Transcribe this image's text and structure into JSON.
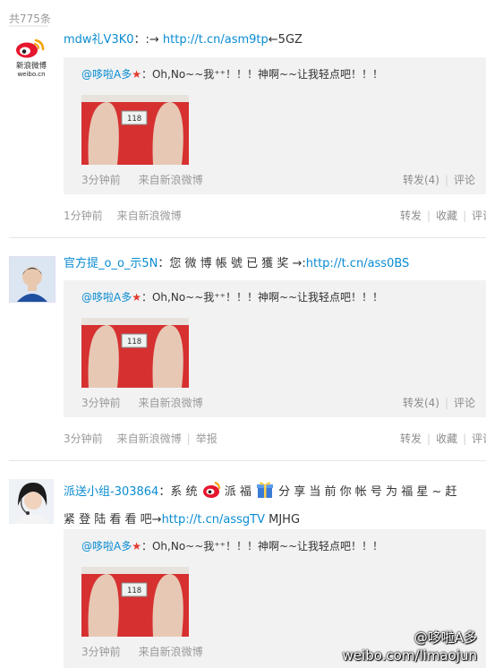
{
  "header": {
    "count_text": "共775条"
  },
  "posts": [
    {
      "author": "mdw礼V3K0",
      "content_prefix": "：:→ ",
      "link": "http://t.cn/asm9tp",
      "content_suffix": "←5GZ",
      "avatar_icon": "sina-weibo-logo-icon",
      "logo_caption_cn": "新浪微博",
      "logo_caption_en": "weibo.cn",
      "repost": {
        "author": "@哆啦A多",
        "text": "：Oh,No~~我⁺⁺！！！神啊~~让我轻点吧！！！",
        "time": "3分钟前",
        "source": "来自新浪微博",
        "forward": "转发(4)",
        "comment": "评论"
      },
      "time": "1分钟前",
      "source": "来自新浪微博",
      "actions": [
        "转发",
        "收藏",
        "评论"
      ]
    },
    {
      "author": "官方提_o_o_示5N",
      "content_prefix": "：您 微 博 帳 號 已 獲 奖 →:",
      "link": "http://t.cn/ass0BS",
      "content_suffix": "",
      "avatar_icon": "user-avatar-icon",
      "repost": {
        "author": "@哆啦A多",
        "text": "：Oh,No~~我⁺⁺！！！神啊~~让我轻点吧！！！",
        "time": "3分钟前",
        "source": "来自新浪微博",
        "forward": "转发(4)",
        "comment": "评论"
      },
      "time": "3分钟前",
      "source": "来自新浪微博",
      "report": "举报",
      "actions": [
        "转发",
        "收藏",
        "评论"
      ]
    },
    {
      "author": "派送小组-303864",
      "content_line1_a": "：系 统 ",
      "content_line1_b": " 派 福 ",
      "content_line1_c": " 分 享 当 前 你 帐 号 为 福 星 ~ 赶",
      "content_line2": "紧 登 陆 看 看 吧→",
      "link": "http://t.cn/assgTV",
      "content_suffix": " MJHG",
      "avatar_icon": "user-avatar-icon",
      "repost": {
        "author": "@哆啦A多",
        "text": "：Oh,No~~我⁺⁺！！！神啊~~让我轻点吧！！！",
        "time": "3分钟前",
        "source": "来自新浪微博"
      }
    }
  ],
  "watermark": {
    "line1": "@哆啦A多",
    "line2": "weibo.com/limaojun"
  },
  "colors": {
    "link": "#0a8cd2",
    "meta": "#9a9a9a",
    "repost_bg": "#f2f2f2",
    "scale_red": "#d63030"
  }
}
